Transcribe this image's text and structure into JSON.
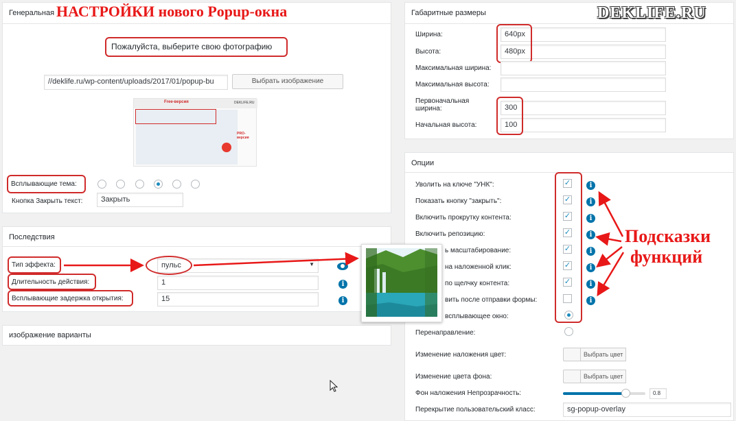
{
  "watermark": "DEKLIFE.RU",
  "heading": "НАСТРОЙКИ нового Popup-окна",
  "general": {
    "title": "Генеральная",
    "choose_photo_label": "Пожалуйста, выберите свою фотографию",
    "image_url": "//deklife.ru/wp-content/uploads/2017/01/popup-bu",
    "choose_image_button": "Выбрать изображение",
    "theme_label": "Всплывающие тема:",
    "theme_selected_index": 3,
    "close_text_label": "Кнопка Закрыть текст:",
    "close_text_value": "Закрыть"
  },
  "effects": {
    "title": "Последствия",
    "effect_type_label": "Тип эффекта:",
    "effect_type_value": "пульс",
    "duration_label": "Длительность действия:",
    "duration_value": "1",
    "delay_label": "Всплывающие задержка открытия:",
    "delay_value": "15"
  },
  "image_options": {
    "title": "изображение варианты"
  },
  "dimensions": {
    "title": "Габаритные размеры",
    "width_label": "Ширина:",
    "width_value": "640px",
    "height_label": "Высота:",
    "height_value": "480px",
    "max_width_label": "Максимальная ширина:",
    "max_width_value": "",
    "max_height_label": "Максимальная высота:",
    "max_height_value": "",
    "initial_width_label_1": "Первоначальная",
    "initial_width_label_2": "ширина:",
    "initial_width_value": "300",
    "initial_height_label": "Начальная высота:",
    "initial_height_value": "100"
  },
  "options": {
    "title": "Опции",
    "items": [
      {
        "label": "Уволить на ключе \"УНК\":",
        "checked": true
      },
      {
        "label": "Показать кнопку \"закрыть\":",
        "checked": true
      },
      {
        "label": "Включить прокрутку контента:",
        "checked": true
      },
      {
        "label": "Включить репозицию:",
        "checked": true
      },
      {
        "label": "ь масштабирование:",
        "checked": true
      },
      {
        "label": "на наложенной клик:",
        "checked": true
      },
      {
        "label": "по щелчку контента:",
        "checked": true
      },
      {
        "label": "вить после отправки формы:",
        "checked": false
      }
    ],
    "popup_window_label": "всплывающее окно:",
    "redirect_label": "Перенаправление:",
    "overlay_color_label": "Изменение наложения цвет:",
    "overlay_color_button": "Выбрать цвет",
    "bg_color_label": "Изменение цвета фона:",
    "bg_color_button": "Выбрать цвет",
    "opacity_label": "Фон наложения Непрозрачность:",
    "opacity_value": "0.8",
    "custom_class_label": "Перекрытие пользовательский класс:",
    "custom_class_value": "sg-popup-overlay"
  },
  "annotation": {
    "line1": "Подсказки",
    "line2": "функций"
  },
  "thumbnail": {
    "header_left": "Free-версия",
    "header_right": "DEKLIFE.RU",
    "pro_label": "PRO-версия"
  },
  "colors": {
    "accent": "#0073aa",
    "highlight": "#d02a2a",
    "heading_red": "#e81818"
  }
}
